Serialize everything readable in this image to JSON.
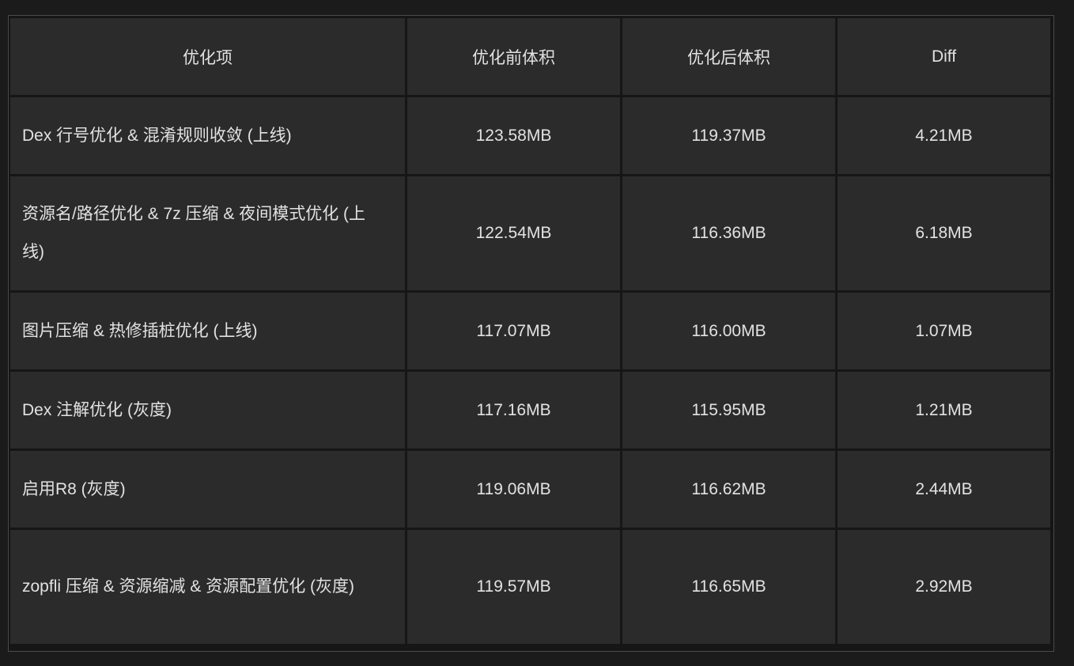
{
  "table": {
    "headers": [
      "优化项",
      "优化前体积",
      "优化后体积",
      "Diff"
    ],
    "rows": [
      {
        "item": "Dex 行号优化 & 混淆规则收敛 (上线)",
        "before": "123.58MB",
        "after": "119.37MB",
        "diff": "4.21MB"
      },
      {
        "item": "资源名/路径优化 & 7z 压缩 & 夜间模式优化 (上线)",
        "before": "122.54MB",
        "after": "116.36MB",
        "diff": "6.18MB"
      },
      {
        "item": "图片压缩 & 热修插桩优化 (上线)",
        "before": "117.07MB",
        "after": "116.00MB",
        "diff": "1.07MB"
      },
      {
        "item": "Dex 注解优化 (灰度)",
        "before": "117.16MB",
        "after": "115.95MB",
        "diff": "1.21MB"
      },
      {
        "item": "启用R8 (灰度)",
        "before": "119.06MB",
        "after": "116.62MB",
        "diff": "2.44MB"
      },
      {
        "item": "zopfli 压缩 & 资源缩减 & 资源配置优化 (灰度)",
        "before": "119.57MB",
        "after": "116.65MB",
        "diff": "2.92MB"
      }
    ]
  },
  "colors": {
    "background": "#1b1b1b",
    "cell": "#2b2b2b",
    "text": "#e2e2e2",
    "border": "#4a4a4a"
  }
}
